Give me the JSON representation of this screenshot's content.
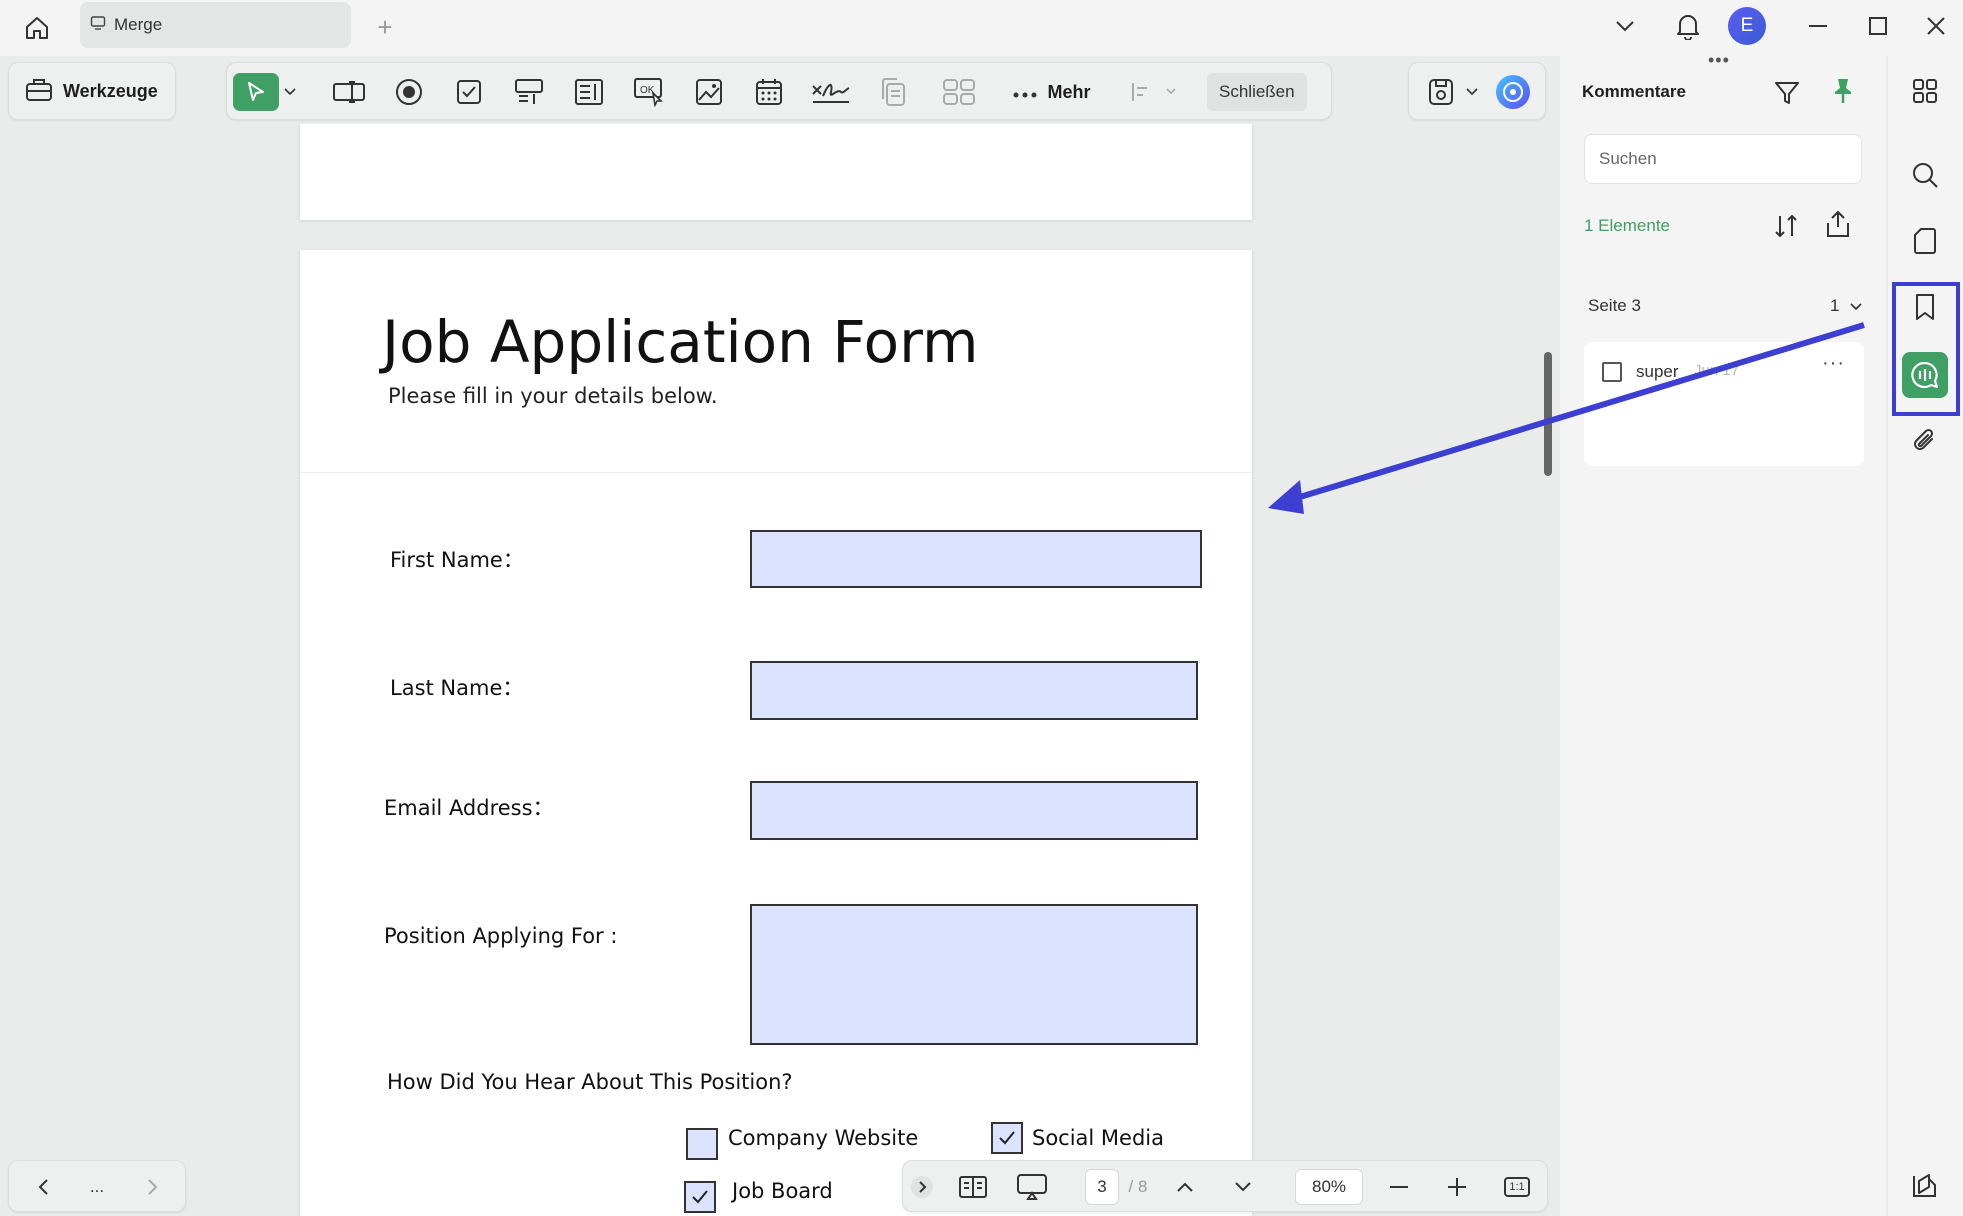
{
  "titlebar": {
    "tab_label": "Merge",
    "avatar_initial": "E"
  },
  "toolbar": {
    "tools_label": "Werkzeuge",
    "more_label": "Mehr",
    "close_label": "Schließen",
    "icons": [
      "select-arrow-icon",
      "text-field-icon",
      "radio-button-icon",
      "checkbox-icon",
      "combo-box-icon",
      "list-box-icon",
      "ok-button-icon",
      "image-field-icon",
      "date-field-icon",
      "signature-field-icon",
      "duplicate-icon",
      "grid-icon",
      "align-icon",
      "save-icon",
      "ai-assistant-icon"
    ]
  },
  "document": {
    "title": "Job Application Form",
    "subtitle": "Please fill in your details below.",
    "fields": [
      {
        "label": "First Name：",
        "value": ""
      },
      {
        "label": "Last Name：",
        "value": ""
      },
      {
        "label": "Email Address：",
        "value": ""
      },
      {
        "label": "Position Applying For :",
        "value": ""
      }
    ],
    "question": "How Did You Hear About This Position?",
    "options": [
      {
        "label": "Company Website",
        "checked": false
      },
      {
        "label": "Social Media",
        "checked": true
      },
      {
        "label": "Job Board",
        "checked": true
      }
    ]
  },
  "bottombar": {
    "current_page": "3",
    "total_pages": "/ 8",
    "zoom": "80%",
    "fit_label": "1:1",
    "nav_more": "..."
  },
  "comments_panel": {
    "title": "Kommentare",
    "search_placeholder": "Suchen",
    "count_label": "1 Elemente",
    "page_group": "Seite 3",
    "page_group_count": "1",
    "comment_text": "super",
    "comment_date": "Jun 17"
  },
  "colors": {
    "accent": "#3f9f64",
    "highlight": "#3c3fd1",
    "field_fill": "#dce3ff"
  }
}
